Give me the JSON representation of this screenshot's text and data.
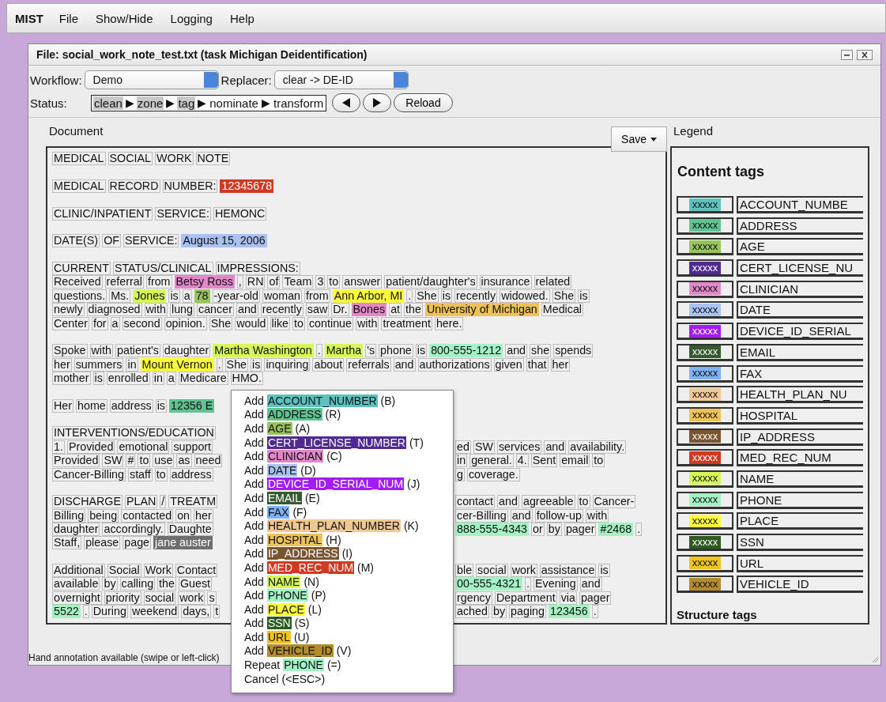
{
  "menubar": {
    "app": "MIST",
    "items": [
      "File",
      "Show/Hide",
      "Logging",
      "Help"
    ]
  },
  "window": {
    "title": "File: social_work_note_test.txt (task Michigan Deidentification)"
  },
  "toolbar": {
    "workflow_label": "Workflow:",
    "workflow": "Demo",
    "replacer_label": "Replacer:",
    "replacer": "clear -> DE-ID",
    "status_label": "Status:",
    "separator": "▶",
    "steps": [
      {
        "label": "clean",
        "done": true
      },
      {
        "label": "zone",
        "done": true
      },
      {
        "label": "tag",
        "done": true
      },
      {
        "label": "nominate",
        "done": false
      },
      {
        "label": "transform",
        "done": false
      }
    ],
    "reload": "Reload"
  },
  "document": {
    "label": "Document",
    "save": "Save",
    "paragraphs": [
      [
        {
          "left": [
            {
              "text": "MEDICAL SOCIAL WORK NOTE"
            }
          ]
        }
      ],
      [
        {
          "left": [
            {
              "text": "MEDICAL RECORD NUMBER:"
            },
            {
              "text": "12345678",
              "color": "#d03a22"
            }
          ]
        }
      ],
      [
        {
          "left": [
            {
              "text": "CLINIC/INPATIENT SERVICE: HEMONC"
            }
          ]
        }
      ],
      [
        {
          "left": [
            {
              "text": "DATE(S) OF SERVICE:"
            },
            {
              "text": "August 15, 2006",
              "color": "#a9c2f2"
            }
          ]
        }
      ],
      [
        {
          "left": [
            {
              "text": "CURRENT STATUS/CLINICAL IMPRESSIONS:"
            }
          ]
        },
        {
          "left": [
            {
              "text": "Received referral from"
            },
            {
              "text": "Betsy Ross",
              "color": "#e288c8"
            },
            {
              "text": ", RN of Team 3 to answer patient/daughter's insurance related"
            }
          ]
        },
        {
          "left": [
            {
              "text": "questions. Ms."
            },
            {
              "text": "Jones",
              "color": "#d6f75a"
            },
            {
              "text": "is a"
            },
            {
              "text": "78",
              "color": "#98c45c"
            },
            {
              "text": "-year-old woman from"
            },
            {
              "text": "Ann Arbor, MI",
              "color": "#fbfb3c"
            },
            {
              "text": ". She is recently widowed. She is"
            }
          ]
        },
        {
          "left": [
            {
              "text": "newly diagnosed with lung cancer and recently saw Dr."
            },
            {
              "text": "Bones",
              "color": "#e288c8"
            },
            {
              "text": "at the"
            },
            {
              "text": "University of Michigan",
              "color": "#efc257"
            },
            {
              "text": "Medical"
            }
          ]
        },
        {
          "left": [
            {
              "text": "Center for a second opinion. She would like to continue with treatment here."
            }
          ]
        }
      ],
      [
        {
          "left": [
            {
              "text": "Spoke with patient's daughter"
            },
            {
              "text": "Martha Washington",
              "color": "#d6f75a"
            },
            {
              "text": "."
            },
            {
              "text": "Martha",
              "color": "#d6f75a"
            },
            {
              "text": "'s phone is"
            },
            {
              "text": "800-555-1212",
              "color": "#a2f2c4"
            },
            {
              "text": "and she spends"
            }
          ]
        },
        {
          "left": [
            {
              "text": "her summers in"
            },
            {
              "text": "Mount Vernon",
              "color": "#fbfb3c"
            },
            {
              "text": ". She is inquiring about referrals and authorizations given that her"
            }
          ]
        },
        {
          "left": [
            {
              "text": "mother is enrolled in a Medicare HMO."
            }
          ]
        }
      ],
      [
        {
          "left": [
            {
              "text": "Her home address is"
            },
            {
              "text": "12356 E",
              "color": "#62c292"
            }
          ]
        }
      ],
      [
        {
          "left": [
            {
              "text": "INTERVENTIONS/EDUCATION"
            }
          ]
        },
        {
          "left": [
            {
              "text": "1. Provided emotional support"
            }
          ],
          "right": [
            {
              "text": "ed SW services and availability."
            }
          ]
        },
        {
          "left": [
            {
              "text": "Provided SW # to use as need"
            }
          ],
          "right": [
            {
              "text": "in general. 4. Sent email to"
            }
          ]
        },
        {
          "left": [
            {
              "text": "Cancer-Billing staff to address"
            }
          ],
          "right": [
            {
              "text": "g coverage."
            }
          ]
        }
      ],
      [
        {
          "left": [
            {
              "text": "DISCHARGE PLAN / TREATM"
            }
          ],
          "right": [
            {
              "text": "contact and agreeable to Cancer-"
            }
          ]
        },
        {
          "left": [
            {
              "text": "Billing being contacted on her"
            }
          ],
          "right": [
            {
              "text": "cer-Billing and follow-up with"
            }
          ]
        },
        {
          "left": [
            {
              "text": "daughter accordingly. Daughte"
            }
          ],
          "right": [
            {
              "text": "888-555-4343",
              "color": "#a2f2c4"
            },
            {
              "text": "or by pager"
            },
            {
              "text": "#2468",
              "color": "#a2f2c4"
            },
            {
              "text": "."
            }
          ]
        },
        {
          "left": [
            {
              "text": "Staff, please page"
            },
            {
              "text": "jane auster",
              "color": "#6e6e6e"
            }
          ]
        }
      ],
      [
        {
          "left": [
            {
              "text": "Additional Social Work Contact"
            }
          ],
          "right": [
            {
              "text": "ble social work assistance is"
            }
          ]
        },
        {
          "left": [
            {
              "text": "available by calling the Guest"
            }
          ],
          "right": [
            {
              "text": "00-555-4321",
              "color": "#a2f2c4"
            },
            {
              "text": ". Evening and"
            }
          ]
        },
        {
          "left": [
            {
              "text": "overnight priority social work s"
            }
          ],
          "right": [
            {
              "text": "rgency Department via pager"
            }
          ]
        },
        {
          "left": [
            {
              "text": "5522",
              "color": "#a2f2c4"
            },
            {
              "text": ". During weekend days, t"
            }
          ],
          "right": [
            {
              "text": "ached by paging"
            },
            {
              "text": "123456",
              "color": "#a2f2c4"
            },
            {
              "text": "."
            }
          ]
        }
      ]
    ]
  },
  "legend": {
    "label": "Legend",
    "heading": "Content tags",
    "footer_heading": "Structure tags",
    "tags": [
      {
        "sample": "xxxxx",
        "label": "ACCOUNT_NUMBE",
        "color": "#5fc0c0"
      },
      {
        "sample": "xxxxx",
        "label": "ADDRESS",
        "color": "#62c292"
      },
      {
        "sample": "xxxxx",
        "label": "AGE",
        "color": "#98c45c"
      },
      {
        "sample": "xxxxx",
        "label": "CERT_LICENSE_NU",
        "color": "#4e2a92"
      },
      {
        "sample": "xxxxx",
        "label": "CLINICIAN",
        "color": "#e288c8"
      },
      {
        "sample": "xxxxx",
        "label": "DATE",
        "color": "#a9c2f2"
      },
      {
        "sample": "xxxxx",
        "label": "DEVICE_ID_SERIAL",
        "color": "#a21cf6"
      },
      {
        "sample": "xxxxx",
        "label": "EMAIL",
        "color": "#36592f"
      },
      {
        "sample": "xxxxx",
        "label": "FAX",
        "color": "#7fb2f5"
      },
      {
        "sample": "xxxxx",
        "label": "HEALTH_PLAN_NU",
        "color": "#f0c892"
      },
      {
        "sample": "xxxxx",
        "label": "HOSPITAL",
        "color": "#efc257"
      },
      {
        "sample": "xxxxx",
        "label": "IP_ADDRESS",
        "color": "#7b5532"
      },
      {
        "sample": "xxxxx",
        "label": "MED_REC_NUM",
        "color": "#d03a22"
      },
      {
        "sample": "xxxxx",
        "label": "NAME",
        "color": "#d6f75a"
      },
      {
        "sample": "xxxxx",
        "label": "PHONE",
        "color": "#a2f2c4"
      },
      {
        "sample": "xxxxx",
        "label": "PLACE",
        "color": "#fbfb3c"
      },
      {
        "sample": "xxxxx",
        "label": "SSN",
        "color": "#2d5a1e"
      },
      {
        "sample": "xxxxx",
        "label": "URL",
        "color": "#f0c41e"
      },
      {
        "sample": "xxxxx",
        "label": "VEHICLE_ID",
        "color": "#b48c2c"
      }
    ]
  },
  "context_menu": [
    {
      "verb": "Add",
      "tag": "ACCOUNT_NUMBER",
      "color": "#5fc0c0",
      "key": "(B)"
    },
    {
      "verb": "Add",
      "tag": "ADDRESS",
      "color": "#62c292",
      "key": "(R)"
    },
    {
      "verb": "Add",
      "tag": "AGE",
      "color": "#98c45c",
      "key": "(A)"
    },
    {
      "verb": "Add",
      "tag": "CERT_LICENSE_NUMBER",
      "color": "#4e2a92",
      "key": "(T)"
    },
    {
      "verb": "Add",
      "tag": "CLINICIAN",
      "color": "#e288c8",
      "key": "(C)"
    },
    {
      "verb": "Add",
      "tag": "DATE",
      "color": "#a9c2f2",
      "key": "(D)"
    },
    {
      "verb": "Add",
      "tag": "DEVICE_ID_SERIAL_NUM",
      "color": "#a21cf6",
      "key": "(J)"
    },
    {
      "verb": "Add",
      "tag": "EMAIL",
      "color": "#36592f",
      "key": "(E)"
    },
    {
      "verb": "Add",
      "tag": "FAX",
      "color": "#7fb2f5",
      "key": "(F)"
    },
    {
      "verb": "Add",
      "tag": "HEALTH_PLAN_NUMBER",
      "color": "#f0c892",
      "key": "(K)"
    },
    {
      "verb": "Add",
      "tag": "HOSPITAL",
      "color": "#efc257",
      "key": "(H)"
    },
    {
      "verb": "Add",
      "tag": "IP_ADDRESS",
      "color": "#7b5532",
      "key": "(I)"
    },
    {
      "verb": "Add",
      "tag": "MED_REC_NUM",
      "color": "#d03a22",
      "key": "(M)"
    },
    {
      "verb": "Add",
      "tag": "NAME",
      "color": "#d6f75a",
      "key": "(N)"
    },
    {
      "verb": "Add",
      "tag": "PHONE",
      "color": "#a2f2c4",
      "key": "(P)"
    },
    {
      "verb": "Add",
      "tag": "PLACE",
      "color": "#fbfb3c",
      "key": "(L)"
    },
    {
      "verb": "Add",
      "tag": "SSN",
      "color": "#2d5a1e",
      "key": "(S)"
    },
    {
      "verb": "Add",
      "tag": "URL",
      "color": "#f0c41e",
      "key": "(U)"
    },
    {
      "verb": "Add",
      "tag": "VEHICLE_ID",
      "color": "#b48c2c",
      "key": "(V)"
    },
    {
      "verb": "Repeat",
      "tag": "PHONE",
      "color": "#a2f2c4",
      "key": "(=)"
    },
    {
      "verb": "Cancel",
      "key": "(<ESC>)"
    }
  ],
  "status_bar": "Hand annotation available (swipe or left-click)"
}
